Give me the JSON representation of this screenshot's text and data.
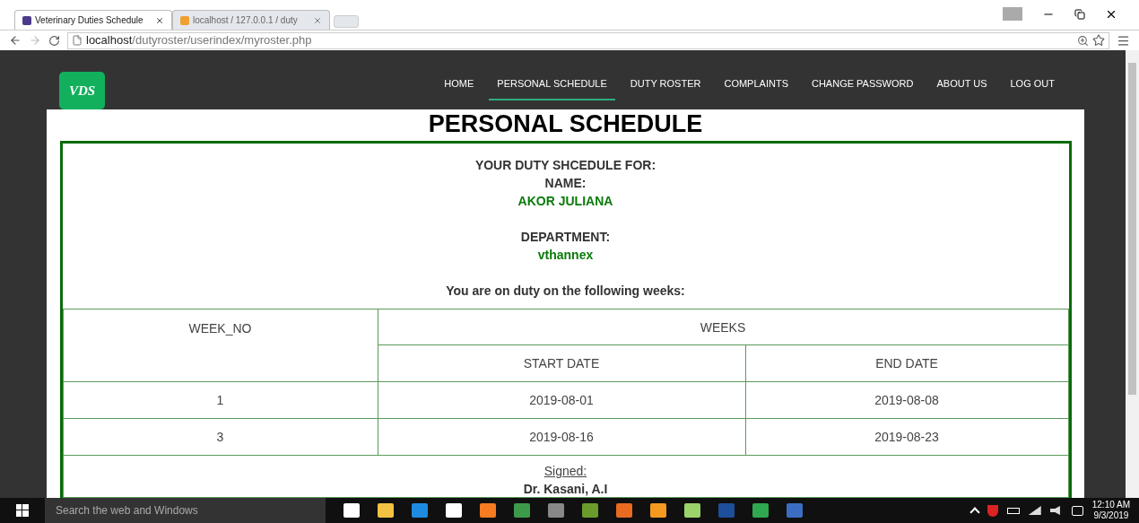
{
  "browser": {
    "tabs": [
      {
        "title": "Veterinary Duties Schedule",
        "selected": true
      },
      {
        "title": "localhost / 127.0.0.1 / duty",
        "selected": false
      }
    ],
    "url_host": "localhost",
    "url_path": "/dutyroster/userindex/myroster.php"
  },
  "site": {
    "logo": "VDS",
    "nav": [
      {
        "label": "HOME",
        "selected": false
      },
      {
        "label": "PERSONAL SCHEDULE",
        "selected": true
      },
      {
        "label": "DUTY ROSTER",
        "selected": false
      },
      {
        "label": "COMPLAINTS",
        "selected": false
      },
      {
        "label": "CHANGE PASSWORD",
        "selected": false
      },
      {
        "label": "ABOUT US",
        "selected": false
      },
      {
        "label": "LOG OUT",
        "selected": false
      }
    ]
  },
  "page": {
    "title": "PERSONAL SCHEDULE",
    "heading": "YOUR DUTY SHCEDULE FOR:",
    "name_label": "NAME:",
    "name": "AKOR JULIANA",
    "department_label": "DEPARTMENT:",
    "department": "vthannex",
    "intro": "You are on duty on the following weeks:",
    "table": {
      "week_no": "WEEK_NO",
      "weeks": "WEEKS",
      "start": "START DATE",
      "end": "END DATE",
      "rows": [
        {
          "week": "1",
          "start": "2019-08-01",
          "end": "2019-08-08"
        },
        {
          "week": "3",
          "start": "2019-08-16",
          "end": "2019-08-23"
        }
      ]
    },
    "signed_label": "Signed:",
    "signer": "Dr. Kasani, A.I"
  },
  "taskbar": {
    "search": "Search the web and Windows",
    "time": "12:10 AM",
    "date": "9/3/2019"
  }
}
